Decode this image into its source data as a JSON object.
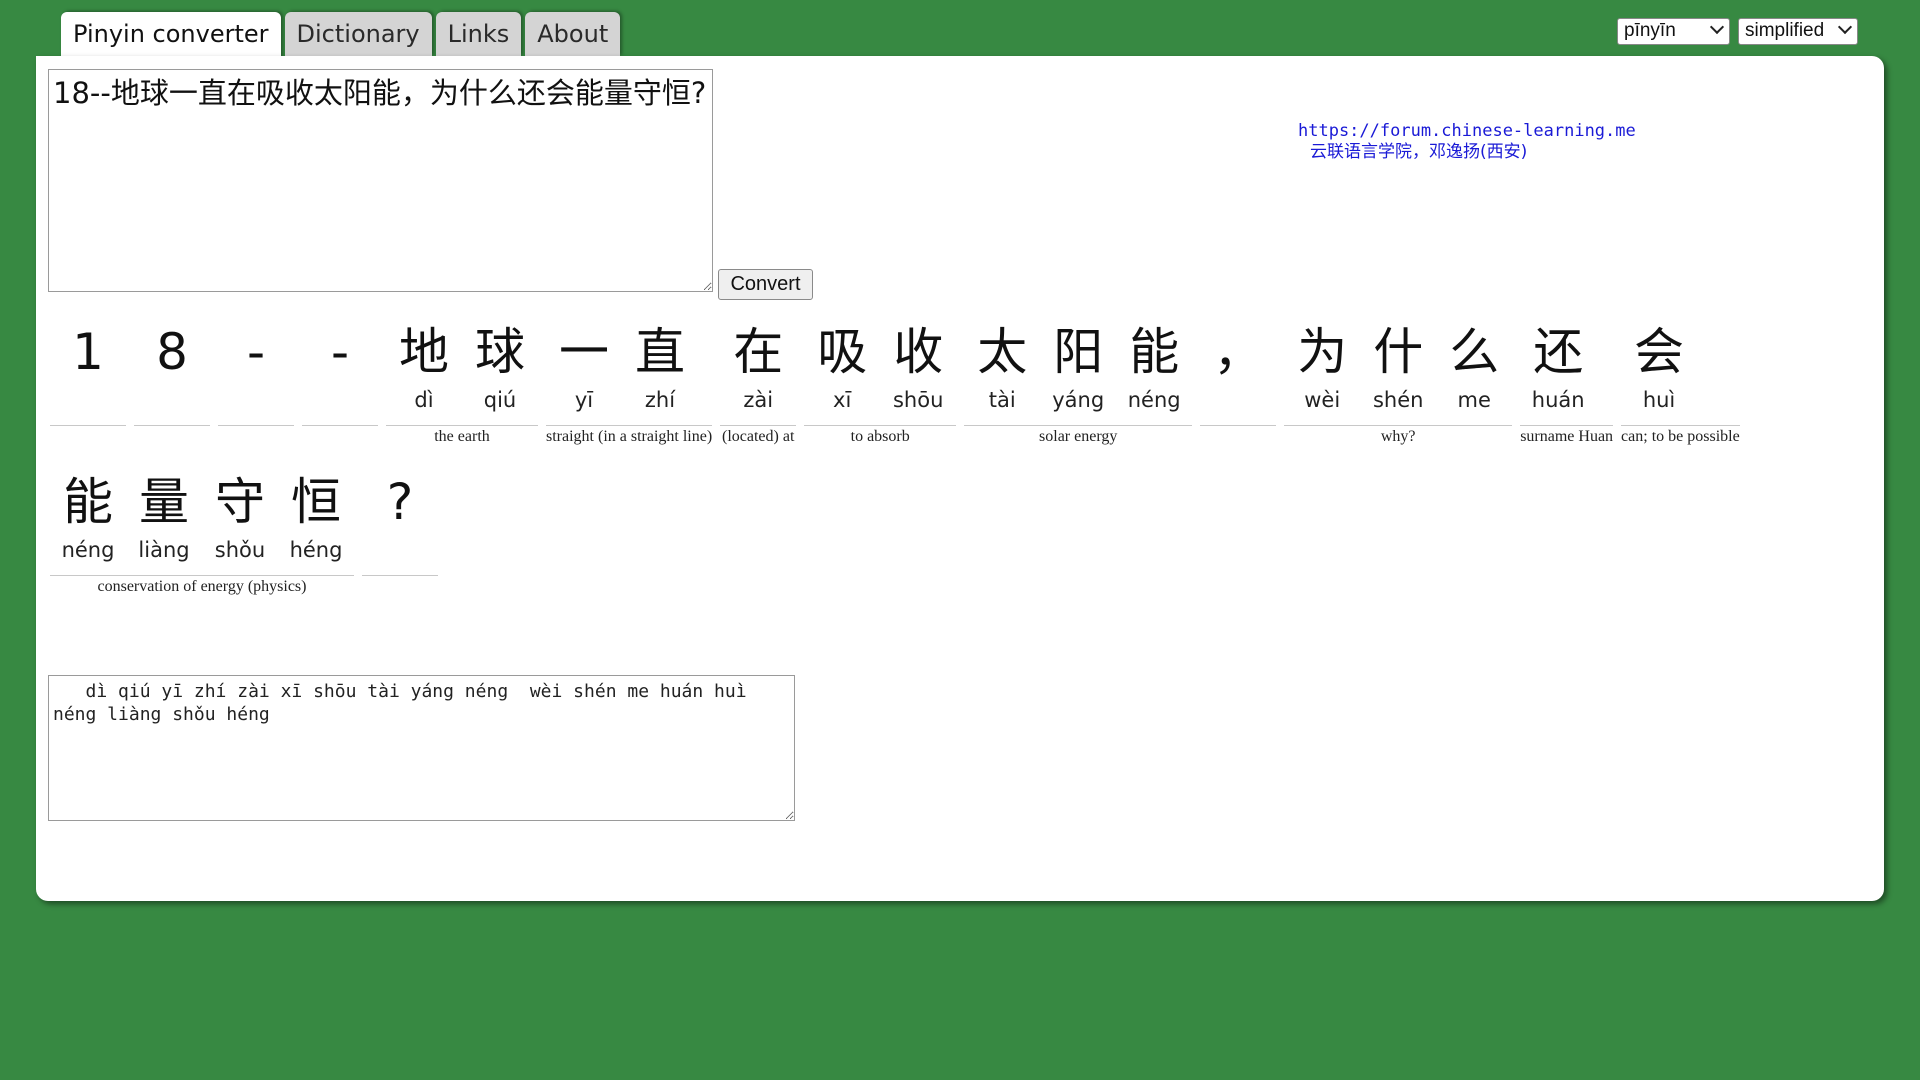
{
  "tabs": [
    {
      "label": "Pinyin converter",
      "active": true
    },
    {
      "label": "Dictionary",
      "active": false
    },
    {
      "label": "Links",
      "active": false
    },
    {
      "label": "About",
      "active": false
    }
  ],
  "selects": {
    "tone_style": "pīnyīn",
    "script": "simplified"
  },
  "input": {
    "value": "18--地球一直在吸收太阳能，为什么还会能量守恒?"
  },
  "convert_label": "Convert",
  "site": {
    "url": "https://forum.chinese-learning.me",
    "org": "云联语言学院，邓逸扬(西安)"
  },
  "lines": [
    [
      {
        "syllables": [
          {
            "h": "1",
            "p": ""
          }
        ],
        "gloss": ""
      },
      {
        "syllables": [
          {
            "h": "8",
            "p": ""
          }
        ],
        "gloss": ""
      },
      {
        "syllables": [
          {
            "h": "-",
            "p": ""
          }
        ],
        "gloss": ""
      },
      {
        "syllables": [
          {
            "h": "-",
            "p": ""
          }
        ],
        "gloss": ""
      },
      {
        "syllables": [
          {
            "h": "地",
            "p": "dì"
          },
          {
            "h": "球",
            "p": "qiú"
          }
        ],
        "gloss": "the earth"
      },
      {
        "syllables": [
          {
            "h": "一",
            "p": "yī"
          },
          {
            "h": "直",
            "p": "zhí"
          }
        ],
        "gloss": "straight (in a straight line)"
      },
      {
        "syllables": [
          {
            "h": "在",
            "p": "zài"
          }
        ],
        "gloss": "(located) at"
      },
      {
        "syllables": [
          {
            "h": "吸",
            "p": "xī"
          },
          {
            "h": "收",
            "p": "shōu"
          }
        ],
        "gloss": "to absorb"
      },
      {
        "syllables": [
          {
            "h": "太",
            "p": "tài"
          },
          {
            "h": "阳",
            "p": "yáng"
          },
          {
            "h": "能",
            "p": "néng"
          }
        ],
        "gloss": "solar energy"
      },
      {
        "syllables": [
          {
            "h": "，",
            "p": ""
          }
        ],
        "gloss": ""
      },
      {
        "syllables": [
          {
            "h": "为",
            "p": "wèi"
          },
          {
            "h": "什",
            "p": "shén"
          },
          {
            "h": "么",
            "p": "me"
          }
        ],
        "gloss": "why?"
      },
      {
        "syllables": [
          {
            "h": "还",
            "p": "huán"
          }
        ],
        "gloss": "surname Huan"
      },
      {
        "syllables": [
          {
            "h": "会",
            "p": "huì"
          }
        ],
        "gloss": "can; to be possible"
      }
    ],
    [
      {
        "syllables": [
          {
            "h": "能",
            "p": "néng"
          },
          {
            "h": "量",
            "p": "liàng"
          },
          {
            "h": "守",
            "p": "shǒu"
          },
          {
            "h": "恒",
            "p": "héng"
          }
        ],
        "gloss": "conservation of energy (physics)"
      },
      {
        "syllables": [
          {
            "h": "?",
            "p": ""
          }
        ],
        "gloss": ""
      }
    ]
  ],
  "output": {
    "value": "   dì qiú yī zhí zài xī shōu tài yáng néng  wèi shén me huán huì néng liàng shǒu héng"
  }
}
